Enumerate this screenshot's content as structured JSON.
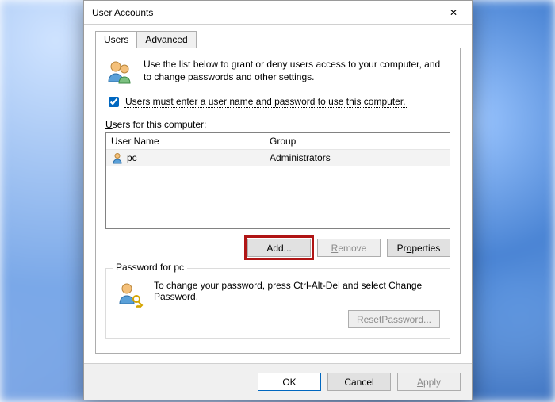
{
  "window": {
    "title": "User Accounts",
    "close_label": "✕"
  },
  "tabs": {
    "users": "Users",
    "advanced": "Advanced"
  },
  "intro": "Use the list below to grant or deny users access to your computer, and to change passwords and other settings.",
  "checkbox": {
    "label": "Users must enter a user name and password to use this computer.",
    "checked": true
  },
  "list": {
    "label_pre": "U",
    "label_rest": "sers for this computer:",
    "columns": {
      "name": "User Name",
      "group": "Group"
    },
    "rows": [
      {
        "name": "pc",
        "group": "Administrators"
      }
    ]
  },
  "buttons": {
    "add": "Add",
    "add_u": "d",
    "add_suffix": "...",
    "remove": "Remove",
    "remove_u": "R",
    "properties": "Pr",
    "properties_u": "o",
    "properties_rest": "perties"
  },
  "password_group": {
    "legend": "Password for pc",
    "text": "To change your password, press Ctrl-Alt-Del and select Change Password.",
    "reset_btn_pre": "Reset ",
    "reset_btn_u": "P",
    "reset_btn_rest": "assword..."
  },
  "footer": {
    "ok": "OK",
    "cancel": "Cancel",
    "apply_u": "A",
    "apply_rest": "pply"
  }
}
